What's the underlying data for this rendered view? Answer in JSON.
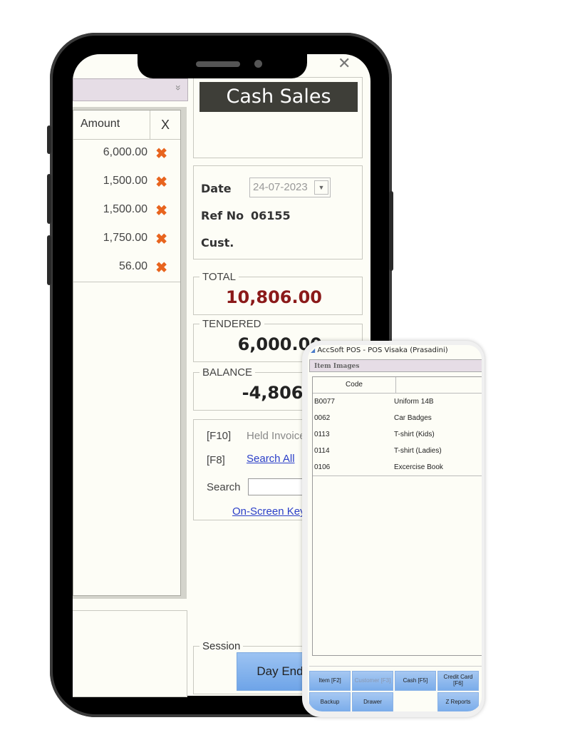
{
  "window": {
    "title": "AccSoft POS - POS Visaka (Prasadini)",
    "close_glyph": "✕"
  },
  "grid": {
    "filter_chevron": "»",
    "headers": {
      "amount": "Amount",
      "delete": "X"
    },
    "rows": [
      {
        "amount": "6,000.00"
      },
      {
        "amount": "1,500.00"
      },
      {
        "amount": "1,500.00"
      },
      {
        "amount": "1,750.00"
      },
      {
        "amount": "56.00"
      }
    ],
    "delete_glyph": "✖"
  },
  "header": {
    "title": "Cash Sales"
  },
  "info": {
    "date_label": "Date",
    "date_value": "24-07-2023",
    "dropdown_glyph": "▼",
    "ref_label": "Ref No",
    "ref_value": "06155",
    "cust_label": "Cust."
  },
  "totals": {
    "total_label": "TOTAL",
    "total_value": "10,806.00",
    "tendered_label": "TENDERED",
    "tendered_value": "6,000.00",
    "balance_label": "BALANCE",
    "balance_value": "-4,806.00"
  },
  "search": {
    "f10_key": "[F10]",
    "f10_label": "Held Invoices",
    "f8_key": "[F8]",
    "f8_label": "Search All",
    "search_label": "Search",
    "search_value": "",
    "keyboard_link": "On-Screen Keyboard"
  },
  "session": {
    "label": "Session",
    "day_end": "Day End"
  },
  "item_images": {
    "tab_label": "Item Images",
    "headers": {
      "code": "Code",
      "description": ""
    },
    "rows": [
      {
        "code": "B0077",
        "description": "Uniform 14B"
      },
      {
        "code": "0062",
        "description": "Car Badges"
      },
      {
        "code": "0113",
        "description": "T-shirt (Kids)"
      },
      {
        "code": "0114",
        "description": "T-shirt (Ladies)"
      },
      {
        "code": "0106",
        "description": "Excercise Book"
      }
    ]
  },
  "buttons": {
    "item": "Item [F2]",
    "customer": "Customer [F3]",
    "cash": "Cash [F5]",
    "credit_card": "Credit Card [F6]",
    "backup": "Backup",
    "drawer": "Drawer",
    "z_reports": "Z Reports"
  },
  "colors": {
    "total_value": "#8b1a1a",
    "delete_icon": "#e8641e",
    "title_bar": "#3e3e38",
    "link": "#2a3ec8",
    "button": "#7aacea"
  }
}
